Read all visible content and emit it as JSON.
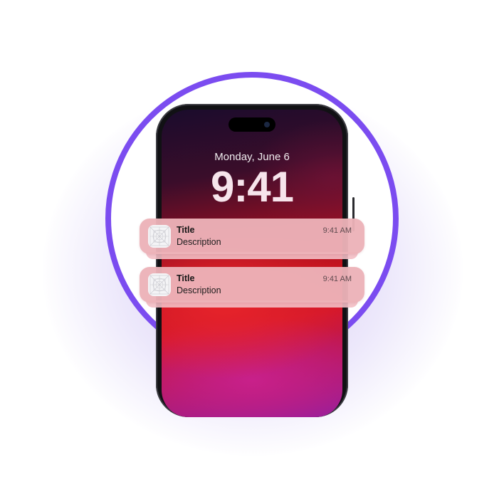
{
  "lockscreen": {
    "date": "Monday, June 6",
    "time": "9:41"
  },
  "notifications": [
    {
      "title": "Title",
      "description": "Description",
      "time": "9:41 AM",
      "icon": "app-placeholder-icon"
    },
    {
      "title": "Title",
      "description": "Description",
      "time": "9:41 AM",
      "icon": "app-placeholder-icon"
    }
  ],
  "colors": {
    "ring": "#7b4cf0",
    "notification_bg": "#ecb2b8",
    "wallpaper_red": "#d3172b",
    "wallpaper_purple": "#8d1ea2"
  }
}
